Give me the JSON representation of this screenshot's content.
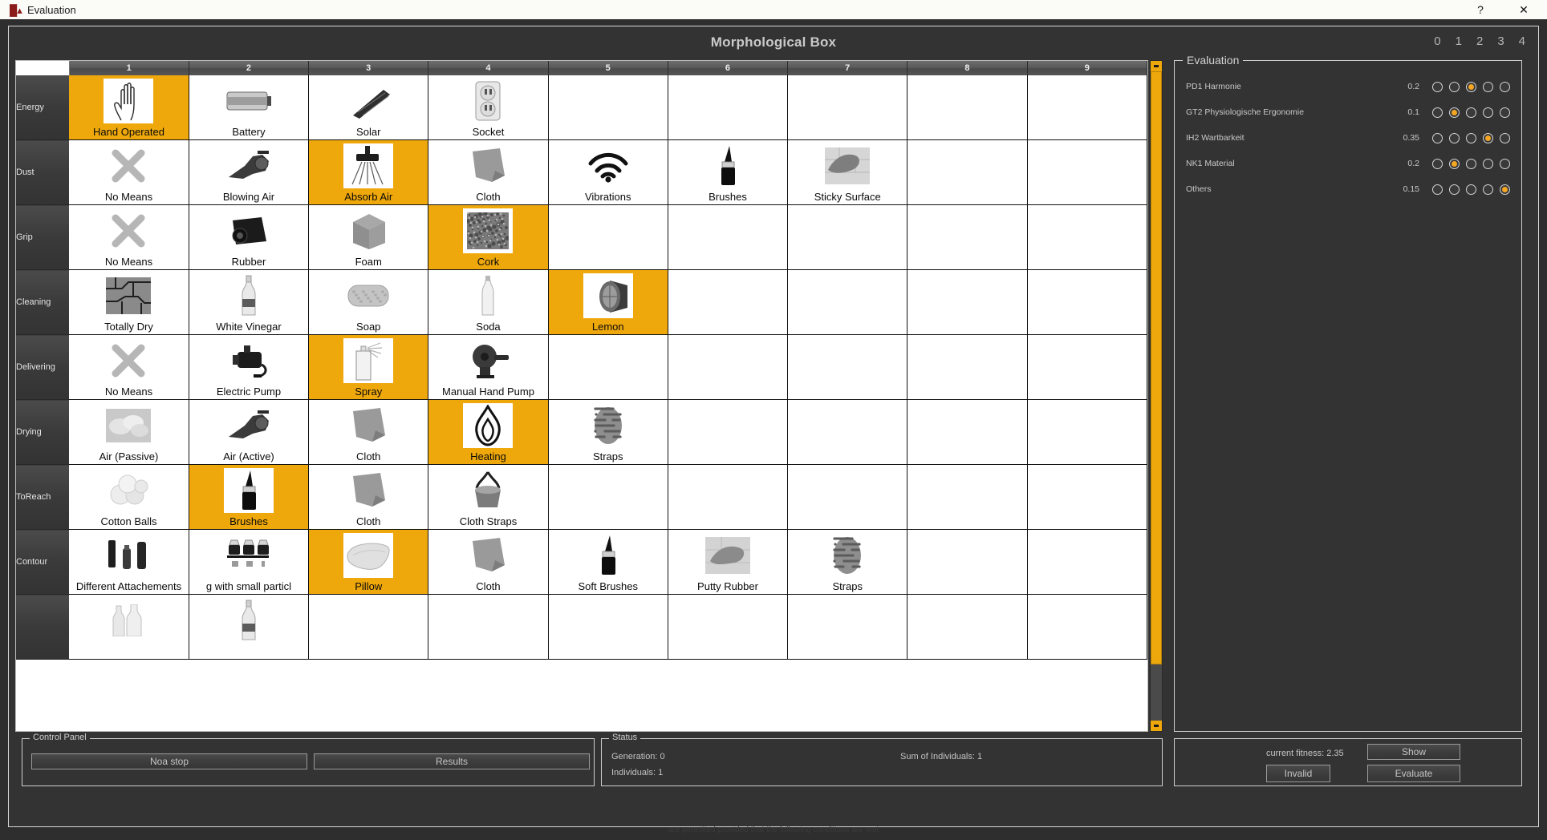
{
  "window": {
    "title": "Evaluation",
    "app_icon": "app-icon",
    "help_label": "?",
    "close_label": "✕"
  },
  "header": {
    "title": "Morphological Box",
    "scale_numbers": [
      "0",
      "1",
      "2",
      "3",
      "4"
    ]
  },
  "grid": {
    "column_headers": [
      "1",
      "2",
      "3",
      "4",
      "5",
      "6",
      "7",
      "8",
      "9"
    ],
    "rows": [
      {
        "label": "Energy",
        "cells": [
          {
            "label": "Hand Operated",
            "icon": "hand-icon",
            "selected": true
          },
          {
            "label": "Battery",
            "icon": "battery-icon",
            "selected": false
          },
          {
            "label": "Solar",
            "icon": "solar-panel-icon",
            "selected": false
          },
          {
            "label": "Socket",
            "icon": "power-socket-icon",
            "selected": false
          },
          {
            "label": "",
            "icon": "",
            "selected": false
          },
          {
            "label": "",
            "icon": "",
            "selected": false
          },
          {
            "label": "",
            "icon": "",
            "selected": false
          },
          {
            "label": "",
            "icon": "",
            "selected": false
          },
          {
            "label": "",
            "icon": "",
            "selected": false
          }
        ]
      },
      {
        "label": "Dust",
        "cells": [
          {
            "label": "No Means",
            "icon": "cross-icon",
            "selected": false
          },
          {
            "label": "Blowing  Air",
            "icon": "blower-icon",
            "selected": false
          },
          {
            "label": "Absorb   Air",
            "icon": "vacuum-nozzle-icon",
            "selected": true
          },
          {
            "label": "Cloth",
            "icon": "cloth-icon",
            "selected": false
          },
          {
            "label": "Vibrations",
            "icon": "vibration-waves-icon",
            "selected": false
          },
          {
            "label": "Brushes",
            "icon": "brush-icon",
            "selected": false
          },
          {
            "label": "Sticky Surface",
            "icon": "sticky-surface-icon",
            "selected": false
          },
          {
            "label": "",
            "icon": "",
            "selected": false
          },
          {
            "label": "",
            "icon": "",
            "selected": false
          }
        ]
      },
      {
        "label": "Grip",
        "cells": [
          {
            "label": "No Means",
            "icon": "cross-icon",
            "selected": false
          },
          {
            "label": "Rubber",
            "icon": "rubber-roll-icon",
            "selected": false
          },
          {
            "label": "Foam",
            "icon": "foam-cube-icon",
            "selected": false
          },
          {
            "label": "Cork",
            "icon": "cork-texture-icon",
            "selected": true
          },
          {
            "label": "",
            "icon": "",
            "selected": false
          },
          {
            "label": "",
            "icon": "",
            "selected": false
          },
          {
            "label": "",
            "icon": "",
            "selected": false
          },
          {
            "label": "",
            "icon": "",
            "selected": false
          },
          {
            "label": "",
            "icon": "",
            "selected": false
          }
        ]
      },
      {
        "label": "Cleaning",
        "cells": [
          {
            "label": "Totally    Dry",
            "icon": "dry-ground-icon",
            "selected": false
          },
          {
            "label": "White Vinegar",
            "icon": "bottle-icon",
            "selected": false
          },
          {
            "label": "Soap",
            "icon": "soap-bar-icon",
            "selected": false
          },
          {
            "label": "Soda",
            "icon": "soda-bottle-icon",
            "selected": false
          },
          {
            "label": "Lemon",
            "icon": "lemon-icon",
            "selected": true
          },
          {
            "label": "",
            "icon": "",
            "selected": false
          },
          {
            "label": "",
            "icon": "",
            "selected": false
          },
          {
            "label": "",
            "icon": "",
            "selected": false
          },
          {
            "label": "",
            "icon": "",
            "selected": false
          }
        ]
      },
      {
        "label": "Delivering",
        "cells": [
          {
            "label": "No Means",
            "icon": "cross-icon",
            "selected": false
          },
          {
            "label": "Electric Pump",
            "icon": "electric-pump-icon",
            "selected": false
          },
          {
            "label": "Spray",
            "icon": "spray-can-icon",
            "selected": true
          },
          {
            "label": "Manual Hand Pump",
            "icon": "hand-pump-icon",
            "selected": false
          },
          {
            "label": "",
            "icon": "",
            "selected": false
          },
          {
            "label": "",
            "icon": "",
            "selected": false
          },
          {
            "label": "",
            "icon": "",
            "selected": false
          },
          {
            "label": "",
            "icon": "",
            "selected": false
          },
          {
            "label": "",
            "icon": "",
            "selected": false
          }
        ]
      },
      {
        "label": "Drying",
        "cells": [
          {
            "label": "Air  (Passive)",
            "icon": "cloud-icon",
            "selected": false
          },
          {
            "label": "Air    (Active)",
            "icon": "blower-icon",
            "selected": false
          },
          {
            "label": "Cloth",
            "icon": "cloth-icon",
            "selected": false
          },
          {
            "label": "Heating",
            "icon": "flame-icon",
            "selected": true
          },
          {
            "label": "Straps",
            "icon": "straps-icon",
            "selected": false
          },
          {
            "label": "",
            "icon": "",
            "selected": false
          },
          {
            "label": "",
            "icon": "",
            "selected": false
          },
          {
            "label": "",
            "icon": "",
            "selected": false
          },
          {
            "label": "",
            "icon": "",
            "selected": false
          }
        ]
      },
      {
        "label": "ToReach",
        "cells": [
          {
            "label": "Cotton  Balls",
            "icon": "cotton-balls-icon",
            "selected": false
          },
          {
            "label": "Brushes",
            "icon": "brush-icon",
            "selected": true
          },
          {
            "label": "Cloth",
            "icon": "cloth-icon",
            "selected": false
          },
          {
            "label": "Cloth  Straps",
            "icon": "cloth-straps-icon",
            "selected": false
          },
          {
            "label": "",
            "icon": "",
            "selected": false
          },
          {
            "label": "",
            "icon": "",
            "selected": false
          },
          {
            "label": "",
            "icon": "",
            "selected": false
          },
          {
            "label": "",
            "icon": "",
            "selected": false
          },
          {
            "label": "",
            "icon": "",
            "selected": false
          }
        ]
      },
      {
        "label": "Contour",
        "cells": [
          {
            "label": "Different Attachements",
            "icon": "attachments-icon",
            "selected": false
          },
          {
            "label": "g with    small particl",
            "icon": "bags-icon",
            "selected": false
          },
          {
            "label": "Pillow",
            "icon": "pillow-icon",
            "selected": true
          },
          {
            "label": "Cloth",
            "icon": "cloth-icon",
            "selected": false
          },
          {
            "label": "Soft  Brushes",
            "icon": "brush-icon",
            "selected": false
          },
          {
            "label": "Putty Rubber",
            "icon": "putty-rubber-icon",
            "selected": false
          },
          {
            "label": "Straps",
            "icon": "straps-icon",
            "selected": false
          },
          {
            "label": "",
            "icon": "",
            "selected": false
          },
          {
            "label": "",
            "icon": "",
            "selected": false
          }
        ]
      },
      {
        "label": "",
        "cells": [
          {
            "label": "",
            "icon": "bottles-icon",
            "selected": false
          },
          {
            "label": "",
            "icon": "bottle-icon",
            "selected": false
          },
          {
            "label": "",
            "icon": "",
            "selected": true
          },
          {
            "label": "",
            "icon": "",
            "selected": false
          },
          {
            "label": "",
            "icon": "",
            "selected": false
          },
          {
            "label": "",
            "icon": "",
            "selected": false
          },
          {
            "label": "",
            "icon": "",
            "selected": false
          },
          {
            "label": "",
            "icon": "",
            "selected": false
          },
          {
            "label": "",
            "icon": "",
            "selected": false
          }
        ]
      }
    ]
  },
  "control_panel": {
    "legend": "Control Panel",
    "buttons": [
      {
        "label": "Noa stop"
      },
      {
        "label": "Results"
      }
    ]
  },
  "status": {
    "legend": "Status",
    "generation": "Generation:  0",
    "individuals": "Individuals:  1",
    "sum_of_individuals": "Sum of Individuals:  1"
  },
  "evaluation": {
    "legend": "Evaluation",
    "criteria": [
      {
        "name": "PD1 Harmonie",
        "weight": "0.2",
        "rating": 2
      },
      {
        "name": "GT2 Physiologische Ergonomie",
        "weight": "0.1",
        "rating": 1
      },
      {
        "name": "IH2 Wartbarkeit",
        "weight": "0.35",
        "rating": 3
      },
      {
        "name": "NK1 Material",
        "weight": "0.2",
        "rating": 1
      },
      {
        "name": "Others",
        "weight": "0.15",
        "rating": 4
      }
    ],
    "scale_count": 5
  },
  "evaluation_actions": {
    "fitness_label": "current fitness: 2.35",
    "show_label": "Show",
    "invalid_label": "Invalid",
    "evaluate_label": "Evaluate"
  },
  "background": {
    "faint_text": "are permitted provided that the following conditions are met"
  },
  "colors": {
    "accent": "#efa80b",
    "radio_accent": "#f5a623",
    "panel_bg": "#333333",
    "window_bg": "#2e2e2e",
    "titlebar_bg": "#fbfcf8"
  }
}
